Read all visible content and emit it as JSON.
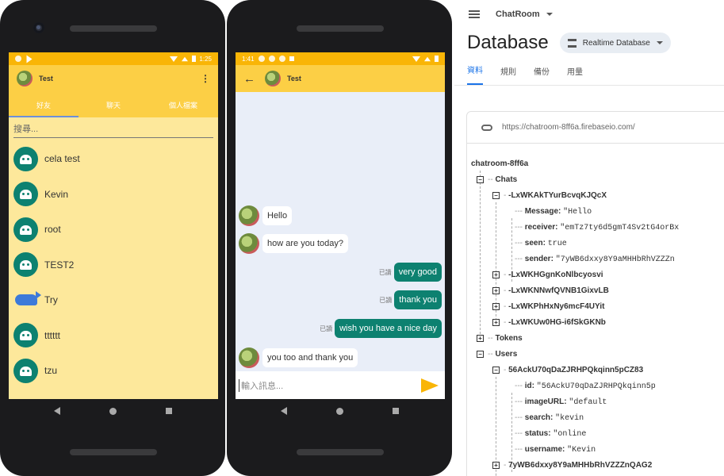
{
  "phone_left": {
    "status_time": "1:25",
    "title": "Test",
    "tabs": [
      "好友",
      "聊天",
      "個人檔案"
    ],
    "search_placeholder": "搜尋...",
    "friends": [
      "cela test",
      "Kevin",
      "root",
      "TEST2",
      "Try",
      "tttttt",
      "tzu"
    ]
  },
  "phone_right": {
    "status_time": "1:41",
    "title": "Test",
    "messages": [
      {
        "dir": "in",
        "text": "Hello"
      },
      {
        "dir": "in",
        "text": "how are you today?"
      },
      {
        "dir": "out",
        "text": "very good",
        "read": "已讀"
      },
      {
        "dir": "out",
        "text": "thank you",
        "read": "已讀"
      },
      {
        "dir": "out",
        "text": "wish you have a nice day",
        "read": "已讀"
      },
      {
        "dir": "in",
        "text": "you too and thank you"
      }
    ],
    "input_placeholder": "輸入訊息..."
  },
  "firebase": {
    "project": "ChatRoom",
    "page_title": "Database",
    "db_selector": "Realtime Database",
    "tabs": [
      "資料",
      "規則",
      "備份",
      "用量"
    ],
    "url": "https://chatroom-8ff6a.firebaseio.com/",
    "tree": {
      "root": "chatroom-8ff6a",
      "chats_label": "Chats",
      "chat_open": "-LxWKAkTYurBcvqKJQcX",
      "chat_fields": [
        {
          "key": "Message:",
          "value": "\"Hello"
        },
        {
          "key": "receiver:",
          "value": "\"emTz7ty6d5gmT4Sv2tG4orBx"
        },
        {
          "key": "seen:",
          "value": "true"
        },
        {
          "key": "sender:",
          "value": "\"7yWB6dxxy8Y9aMHHbRhVZZZn"
        }
      ],
      "chats_collapsed": [
        "-LxWKHGgnKoNlbcyosvi",
        "-LxWKNNwfQVNB1GixvLB",
        "-LxWKPhHxNy6mcF4UYit",
        "-LxWKUw0HG-i6fSkGKNb"
      ],
      "tokens_label": "Tokens",
      "users_label": "Users",
      "user_open": "56AckU70qDaZJRHPQkqinn5pCZ83",
      "user_fields": [
        {
          "key": "id:",
          "value": "\"56AckU70qDaZJRHPQkqinn5p"
        },
        {
          "key": "imageURL:",
          "value": "\"default"
        },
        {
          "key": "search:",
          "value": "\"kevin"
        },
        {
          "key": "status:",
          "value": "\"online"
        },
        {
          "key": "username:",
          "value": "\"Kevin"
        }
      ],
      "user_collapsed": "7yWB6dxxy8Y9aMHHbRhVZZZnQAG2"
    }
  }
}
